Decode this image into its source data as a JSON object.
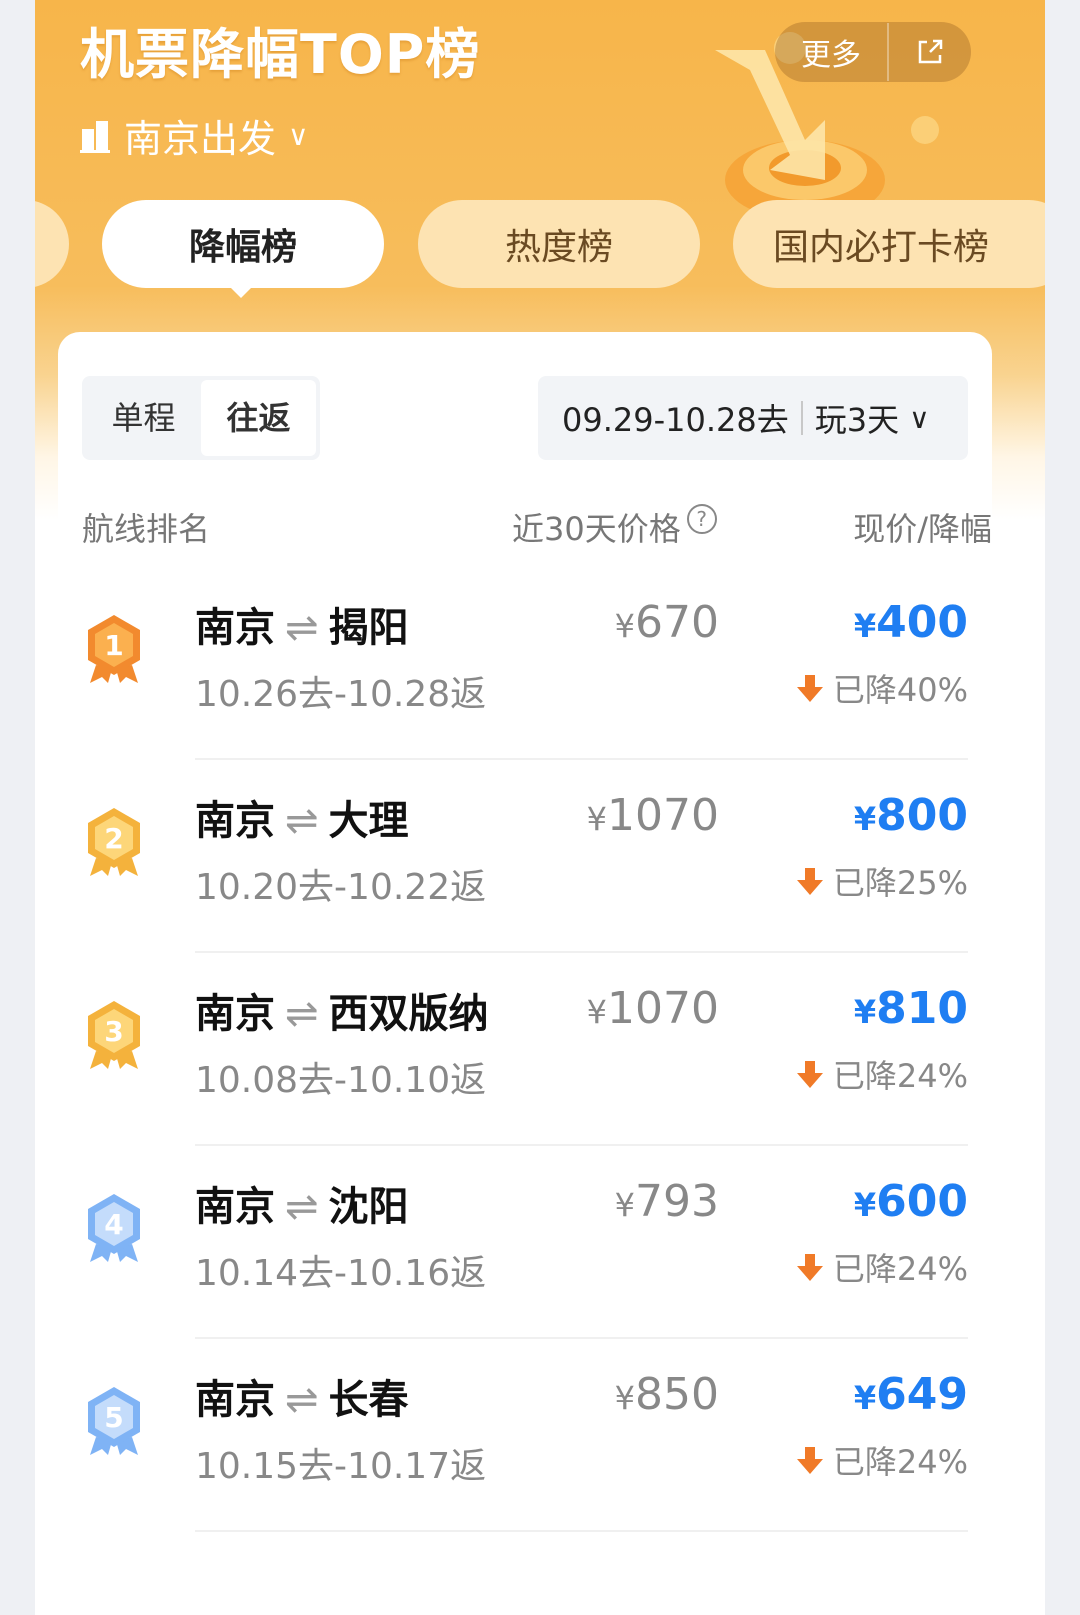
{
  "header": {
    "title": "机票降幅TOP榜",
    "city": "南京出发",
    "more_label": "更多"
  },
  "tabs": [
    {
      "label": "降幅榜",
      "active": true
    },
    {
      "label": "热度榜",
      "active": false
    },
    {
      "label": "国内必打卡榜",
      "active": false
    }
  ],
  "trip_type": {
    "options": [
      "单程",
      "往返"
    ],
    "selected": "往返"
  },
  "date_filter": {
    "range": "09.29-10.28去",
    "duration": "玩3天"
  },
  "columns": {
    "rank": "航线排名",
    "history": "近30天价格",
    "current": "现价/降幅"
  },
  "colors": {
    "accent_blue": "#1f7ef2",
    "header_orange": "#f7b54a",
    "drop_arrow": "#f07a28"
  },
  "routes": [
    {
      "rank": "1",
      "from": "南京",
      "to": "揭阳",
      "dates": "10.26去-10.28返",
      "old_price": "670",
      "now_price": "400",
      "drop": "已降40%",
      "medal": "orange"
    },
    {
      "rank": "2",
      "from": "南京",
      "to": "大理",
      "dates": "10.20去-10.22返",
      "old_price": "1070",
      "now_price": "800",
      "drop": "已降25%",
      "medal": "gold"
    },
    {
      "rank": "3",
      "from": "南京",
      "to": "西双版纳",
      "dates": "10.08去-10.10返",
      "old_price": "1070",
      "now_price": "810",
      "drop": "已降24%",
      "medal": "gold"
    },
    {
      "rank": "4",
      "from": "南京",
      "to": "沈阳",
      "dates": "10.14去-10.16返",
      "old_price": "793",
      "now_price": "600",
      "drop": "已降24%",
      "medal": "blue"
    },
    {
      "rank": "5",
      "from": "南京",
      "to": "长春",
      "dates": "10.15去-10.17返",
      "old_price": "850",
      "now_price": "649",
      "drop": "已降24%",
      "medal": "blue"
    }
  ]
}
